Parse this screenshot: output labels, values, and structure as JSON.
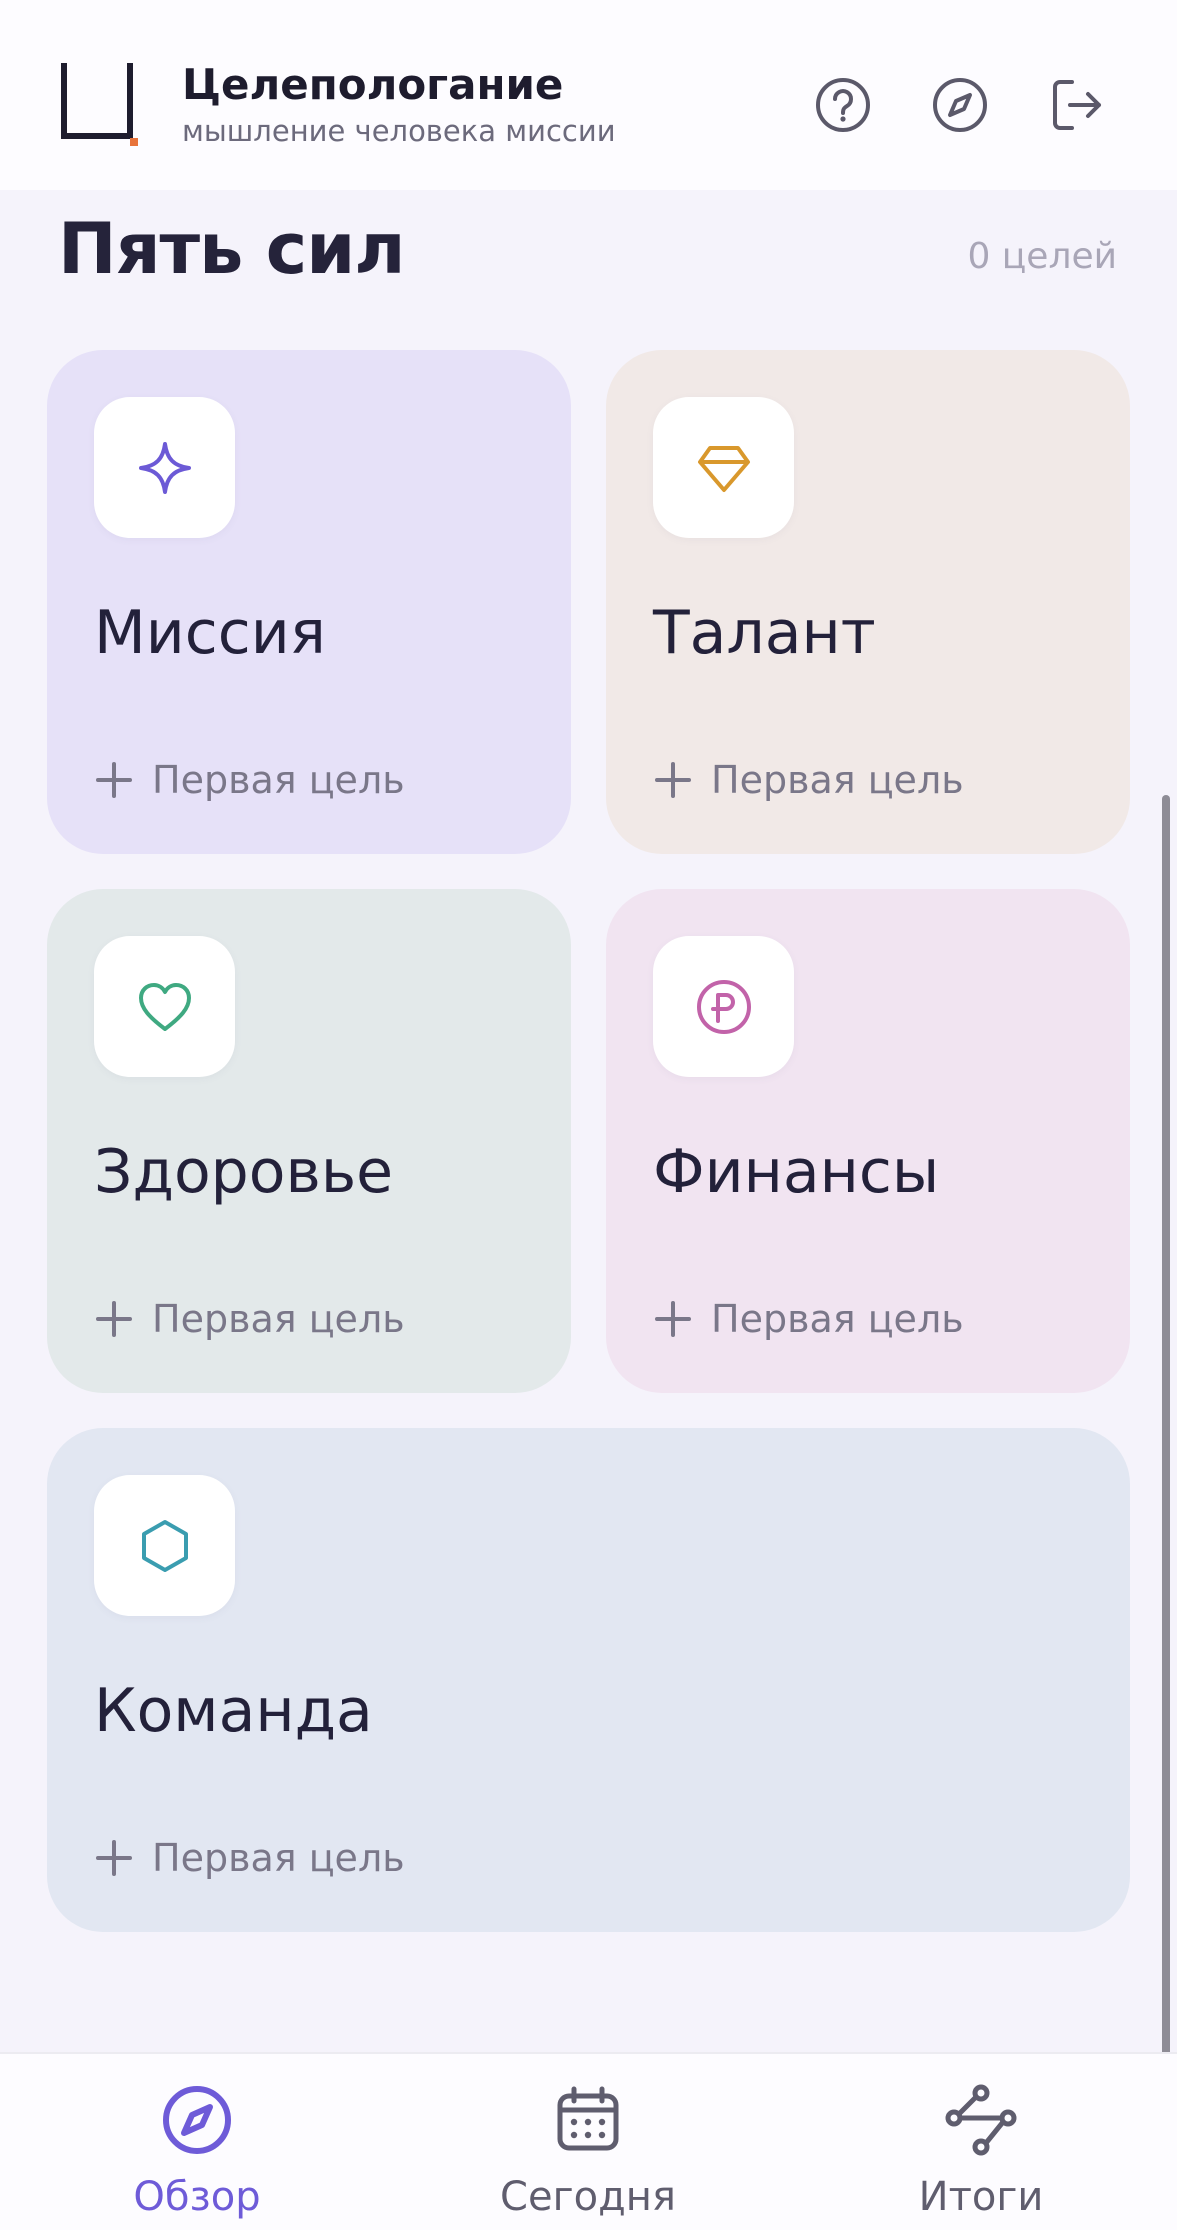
{
  "header": {
    "app_title": "Целепологание",
    "app_subtitle": "мышление человека миссии",
    "logo_icon": "bracket-logo-icon",
    "actions": [
      {
        "icon": "help-icon"
      },
      {
        "icon": "compass-icon"
      },
      {
        "icon": "logout-icon"
      }
    ]
  },
  "section": {
    "title": "Пять сил",
    "count": "0 целей"
  },
  "cards": [
    {
      "title": "Миссия",
      "add_label": "Первая цель",
      "icon": "sparkle-icon",
      "bg": "#e6e1f8",
      "accent": "#6c5ad6"
    },
    {
      "title": "Талант",
      "add_label": "Первая цель",
      "icon": "diamond-icon",
      "bg": "#f1e9e7",
      "accent": "#d9982c"
    },
    {
      "title": "Здоровье",
      "add_label": "Первая цель",
      "icon": "heart-icon",
      "bg": "#e3e9ea",
      "accent": "#3fa981"
    },
    {
      "title": "Финансы",
      "add_label": "Первая цель",
      "icon": "ruble-icon",
      "bg": "#f1e4f1",
      "accent": "#c263a9"
    },
    {
      "title": "Команда",
      "add_label": "Первая цель",
      "icon": "hexagon-icon",
      "bg": "#e2e7f2",
      "accent": "#3a9db0"
    }
  ],
  "bottom_nav": {
    "items": [
      {
        "label": "Обзор",
        "icon": "compass-icon",
        "active": true
      },
      {
        "label": "Сегодня",
        "icon": "calendar-icon",
        "active": false
      },
      {
        "label": "Итоги",
        "icon": "route-icon",
        "active": false
      }
    ]
  },
  "colors": {
    "accent": "#6e5bd8",
    "nav_inactive": "#5f5d6e",
    "background": "#f5f3fb",
    "logo_dot": "#e8743b"
  }
}
